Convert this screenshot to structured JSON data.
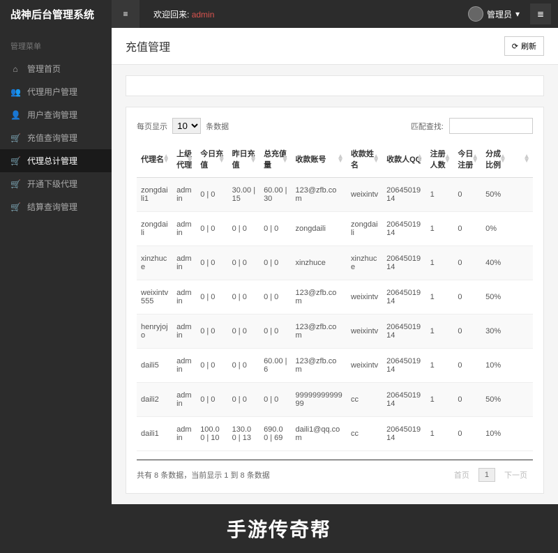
{
  "app": {
    "title": "战神后台管理系统"
  },
  "header": {
    "welcome": "欢迎回来:",
    "username": "admin",
    "admin_label": "管理员"
  },
  "sidebar": {
    "title": "管理菜单",
    "items": [
      {
        "icon": "⌂",
        "label": "管理首页"
      },
      {
        "icon": "👥",
        "label": "代理用户管理"
      },
      {
        "icon": "👤",
        "label": "用户查询管理"
      },
      {
        "icon": "🛒",
        "label": "充值查询管理"
      },
      {
        "icon": "🛒",
        "label": "代理总计管理"
      },
      {
        "icon": "🛒",
        "label": "开通下级代理"
      },
      {
        "icon": "🛒",
        "label": "结算查询管理"
      }
    ]
  },
  "page": {
    "title": "充值管理",
    "refresh": "刷新"
  },
  "table": {
    "show_prefix": "每页显示",
    "show_suffix": "条数据",
    "page_size": "10",
    "search_label": "匹配查找:",
    "headers": [
      "代理名",
      "上级代理",
      "今日充值",
      "昨日充值",
      "总充值量",
      "收款账号",
      "收款姓名",
      "收款人QQ",
      "注册人数",
      "今日注册",
      "分成比例"
    ],
    "rows": [
      {
        "c": [
          "zongdaili1",
          "admin",
          "0 | 0",
          "30.00 | 15",
          "60.00 | 30",
          "123@zfb.com",
          "weixintv",
          "2064501914",
          "1",
          "0",
          "50%"
        ]
      },
      {
        "c": [
          "zongdaili",
          "admin",
          "0 | 0",
          "0 | 0",
          "0 | 0",
          "zongdaili",
          "zongdaili",
          "2064501914",
          "1",
          "0",
          "0%"
        ]
      },
      {
        "c": [
          "xinzhuce",
          "admin",
          "0 | 0",
          "0 | 0",
          "0 | 0",
          "xinzhuce",
          "xinzhuce",
          "2064501914",
          "1",
          "0",
          "40%"
        ]
      },
      {
        "c": [
          "weixintv555",
          "admin",
          "0 | 0",
          "0 | 0",
          "0 | 0",
          "123@zfb.com",
          "weixintv",
          "2064501914",
          "1",
          "0",
          "50%"
        ]
      },
      {
        "c": [
          "henryjojo",
          "admin",
          "0 | 0",
          "0 | 0",
          "0 | 0",
          "123@zfb.com",
          "weixintv",
          "2064501914",
          "1",
          "0",
          "30%"
        ]
      },
      {
        "c": [
          "daili5",
          "admin",
          "0 | 0",
          "0 | 0",
          "60.00 | 6",
          "123@zfb.com",
          "weixintv",
          "2064501914",
          "1",
          "0",
          "10%"
        ]
      },
      {
        "c": [
          "daili2",
          "admin",
          "0 | 0",
          "0 | 0",
          "0 | 0",
          "9999999999999",
          "cc",
          "2064501914",
          "1",
          "0",
          "50%"
        ]
      },
      {
        "c": [
          "daili1",
          "admin",
          "100.00 | 10",
          "130.00 | 13",
          "690.00 | 69",
          "daili1@qq.com",
          "cc",
          "2064501914",
          "1",
          "0",
          "10%"
        ]
      }
    ],
    "summary": "共有 8 条数据，当前显示 1 到 8 条数据",
    "first": "首页",
    "page_num": "1",
    "next": "下一页"
  },
  "footer": {
    "banner": "手游传奇帮"
  }
}
